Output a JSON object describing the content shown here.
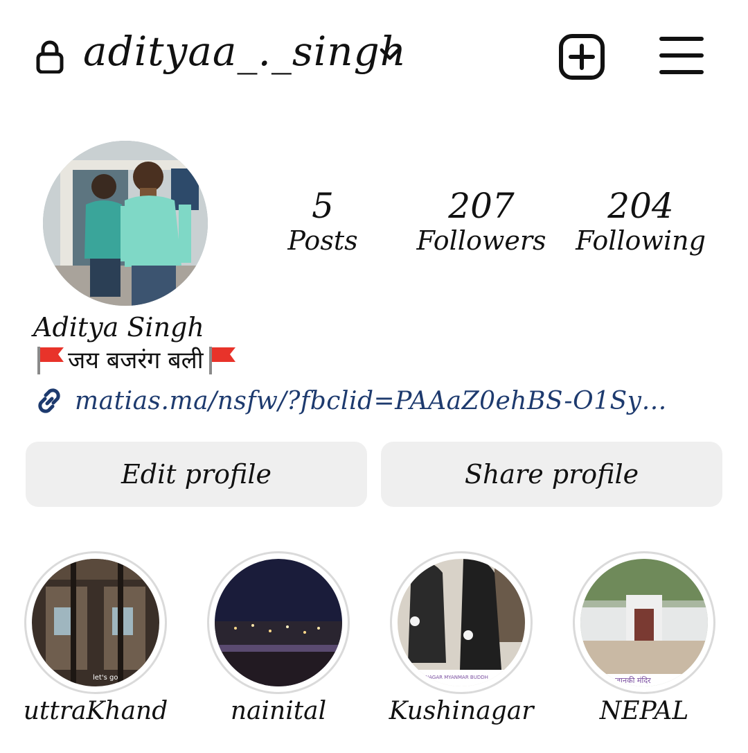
{
  "header": {
    "username": "adityaa_._singh",
    "lock_icon": "lock-icon",
    "dropdown_icon": "chevron-down-icon",
    "create_icon": "plus-square-icon",
    "menu_icon": "hamburger-menu-icon"
  },
  "stats": [
    {
      "value": "5",
      "label": "Posts"
    },
    {
      "value": "207",
      "label": "Followers"
    },
    {
      "value": "204",
      "label": "Following"
    }
  ],
  "profile": {
    "full_name": "Aditya Singh",
    "bio": "जय बजरंग बली",
    "bio_emoji": "flag-icon",
    "link": "matias.ma/nsfw/?fbclid=PAAaZ0ehBS-O1Sy…",
    "link_icon": "link-icon"
  },
  "buttons": {
    "edit": "Edit profile",
    "share": "Share profile"
  },
  "highlights": [
    {
      "label": "uttraKhand"
    },
    {
      "label": "nainital"
    },
    {
      "label": "Kushinagar"
    },
    {
      "label": "NEPAL"
    }
  ],
  "highlight_overlay_text": {
    "uttrakhand": "let's go",
    "kushinagar": "NAGAR MYANMAR BUDDH",
    "nepal": "जानकी मंदिर"
  },
  "colors": {
    "link": "#1d3a6e",
    "button_bg": "#efefef",
    "flag": "#e8332a"
  }
}
